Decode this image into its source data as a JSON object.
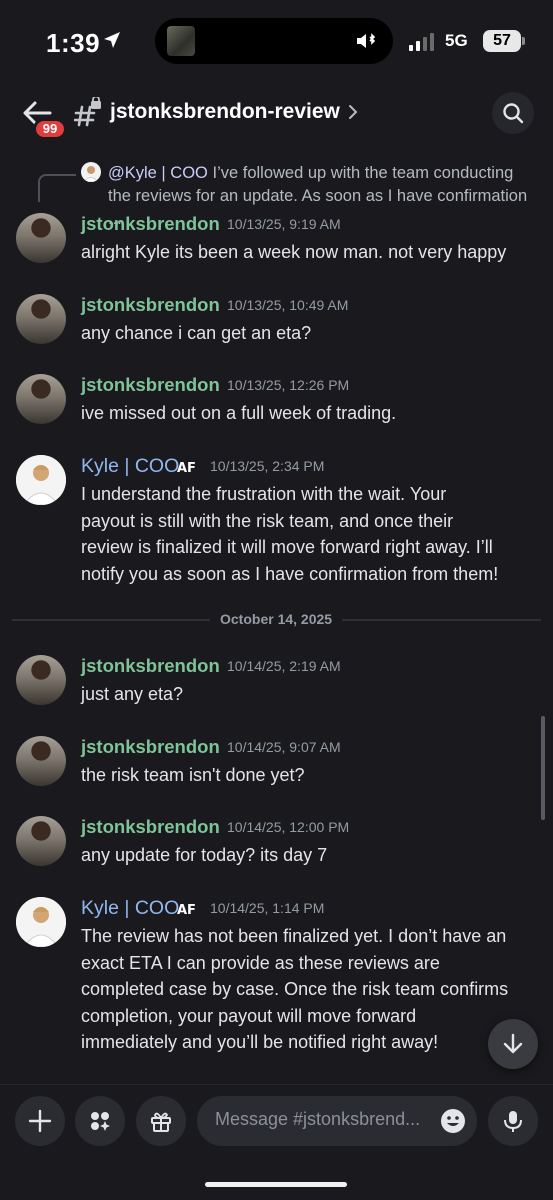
{
  "status_bar": {
    "time": "1:39",
    "network": "5G",
    "battery": "57"
  },
  "header": {
    "badge_count": "99",
    "channel_name": "jstonksbrendon-review"
  },
  "reply_preview": {
    "mention": "@Kyle | COO",
    "text": "I’ve followed up with the team conducting",
    "text_line2": "the reviews for an update. As soon as I have confirmation ..."
  },
  "messages": [
    {
      "author": "jstonksbrendon",
      "timestamp": "10/13/25, 9:19 AM",
      "lines": [
        "alright Kyle its been a week now man. not very happy"
      ]
    },
    {
      "author": "jstonksbrendon",
      "timestamp": "10/13/25, 10:49 AM",
      "lines": [
        "any chance i can get an eta?"
      ]
    },
    {
      "author": "jstonksbrendon",
      "timestamp": "10/13/25, 12:26 PM",
      "lines": [
        "ive missed out on a full week of trading."
      ]
    },
    {
      "author": "Kyle | COO",
      "tag": "AF",
      "timestamp": "10/13/25, 2:34 PM",
      "lines": [
        "I understand the frustration with the wait. Your",
        "payout is still with the risk team, and once their",
        "review is finalized it will move forward right away. I’ll",
        "notify you as soon as I have confirmation from them!"
      ]
    },
    {
      "author": "jstonksbrendon",
      "timestamp": "10/14/25, 2:19 AM",
      "lines": [
        "just any eta?"
      ]
    },
    {
      "author": "jstonksbrendon",
      "timestamp": "10/14/25, 9:07 AM",
      "lines": [
        "the risk team isn't done yet?"
      ]
    },
    {
      "author": "jstonksbrendon",
      "timestamp": "10/14/25, 12:00 PM",
      "lines": [
        "any update for today? its day 7"
      ]
    },
    {
      "author": "Kyle | COO",
      "tag": "AF",
      "timestamp": "10/14/25, 1:14 PM",
      "lines": [
        "The review has not been finalized yet. I don’t have an",
        "exact ETA I can provide as these reviews are",
        "completed case by case. Once the risk team confirms",
        "completion, your payout will move forward",
        "immediately and you’ll be notified right away!"
      ]
    }
  ],
  "date_divider": "October 14, 2025",
  "composer": {
    "placeholder": "Message #jstonksbrend..."
  },
  "colors": {
    "background": "#1a1a1e",
    "brendon_name": "#7fc398",
    "kyle_name": "#8fb8ee",
    "badge": "#e03d3f"
  }
}
